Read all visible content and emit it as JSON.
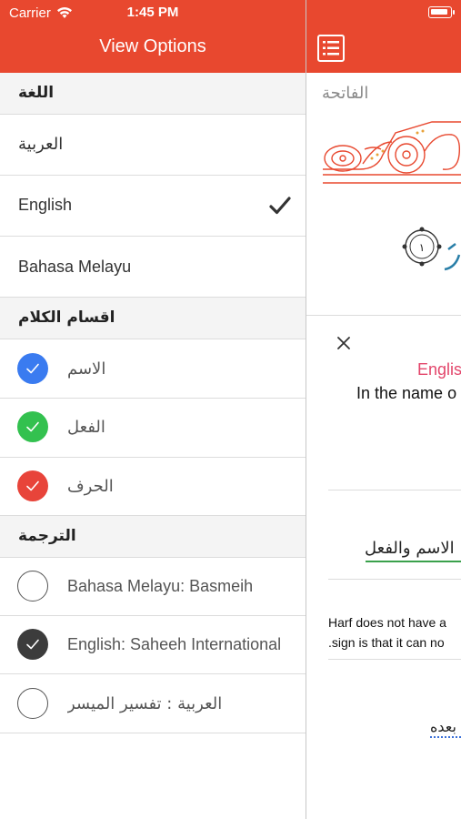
{
  "status_bar": {
    "carrier": "Carrier",
    "time": "1:45 PM"
  },
  "nav": {
    "title": "View Options"
  },
  "sections": {
    "language": "اللغة",
    "parts_of_speech": "اقسام الكلام",
    "translation": "الترجمة"
  },
  "languages": [
    {
      "label": "العربية",
      "selected": false
    },
    {
      "label": "English",
      "selected": true
    },
    {
      "label": "Bahasa Melayu",
      "selected": false
    }
  ],
  "parts_of_speech": [
    {
      "label": "الاسم",
      "color": "#3a7bf0",
      "checked": true
    },
    {
      "label": "الفعل",
      "color": "#33c14f",
      "checked": true
    },
    {
      "label": "الحرف",
      "color": "#e8443a",
      "checked": true
    }
  ],
  "translations": [
    {
      "label": "Bahasa Melayu: Basmeih",
      "checked": false
    },
    {
      "label": "English: Saheeh International",
      "checked": true
    },
    {
      "label": "العربية : تفسير الميسر",
      "checked": false
    }
  ],
  "right_panel": {
    "surah_title": "الفاتحة",
    "ayah_number": "١",
    "english_label": "Englis",
    "english_line": "In the name o",
    "arabic_line": "الاسم والفعل",
    "harf_line1": "Harf does not have a",
    "harf_line2": ".sign is that it can no",
    "arabic_tail": "بعده"
  },
  "colors": {
    "accent": "#e8482f",
    "section_bg": "#f4f4f4",
    "english_label": "#e3466b"
  }
}
